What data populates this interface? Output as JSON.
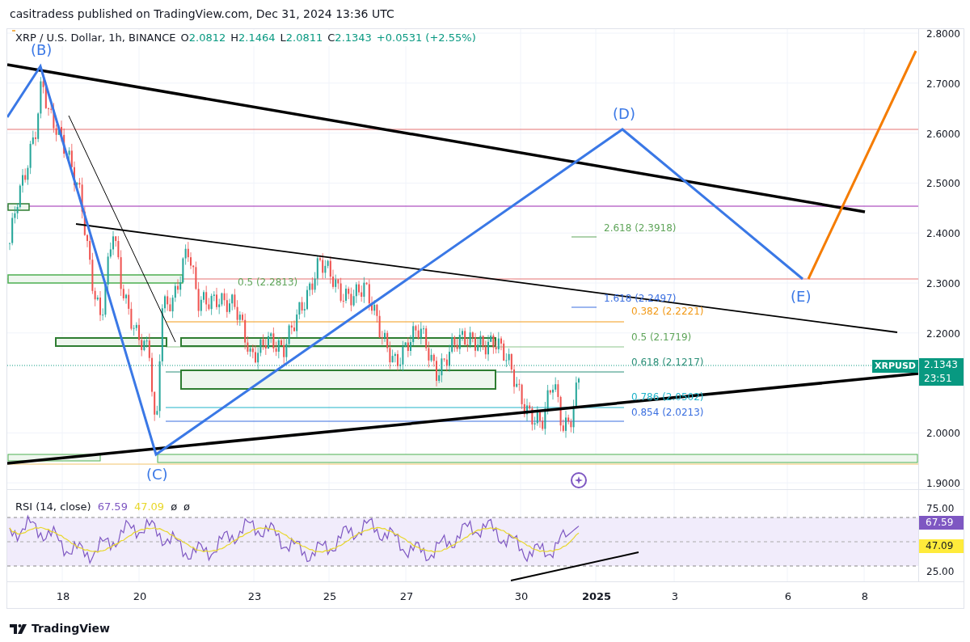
{
  "attribution": "casitradess published on TradingView.com, Dec 31, 2024 13:36 UTC",
  "legend": {
    "symbol": "XRP / U.S. Dollar, 1h, BINANCE",
    "ohlc": [
      {
        "key": "O",
        "value": "2.0812"
      },
      {
        "key": "H",
        "value": "2.1464"
      },
      {
        "key": "L",
        "value": "2.0811"
      },
      {
        "key": "C",
        "value": "2.1343"
      }
    ],
    "change": "+0.0531 (+2.55%)"
  },
  "wave_labels": [
    "(B)",
    "(C)",
    "(D)",
    "(E)"
  ],
  "fib_labels": [
    {
      "text": "2.618 (2.3918)",
      "color": "#5fa55a"
    },
    {
      "text": "0.5 (2.2813)",
      "color": "#5fa55a"
    },
    {
      "text": "1.618 (2.2497)",
      "color": "#3a6fe0"
    },
    {
      "text": "0.382 (2.2221)",
      "color": "#f29a18"
    },
    {
      "text": "0.5 (2.1719)",
      "color": "#5fa55a"
    },
    {
      "text": "0.618 (2.1217)",
      "color": "#2b8f78"
    },
    {
      "text": "0.786 (2.0502)",
      "color": "#1fb3c9"
    },
    {
      "text": "0.854 (2.0213)",
      "color": "#3a6fe0"
    }
  ],
  "price_axis": [
    "2.8000",
    "2.7000",
    "2.6000",
    "2.5000",
    "2.4000",
    "2.3000",
    "2.2000",
    "2.0000",
    "1.9000"
  ],
  "price_tag": {
    "symbol": "XRPUSD",
    "price": "2.1343",
    "countdown": "23:51"
  },
  "rsi": {
    "title": "RSI (14, close)",
    "legend": [
      {
        "text": "67.59",
        "color": "#7e57c2"
      },
      {
        "text": "47.09",
        "color": "#e8d72a"
      },
      {
        "text": "ø",
        "color": "#131722"
      },
      {
        "text": "ø",
        "color": "#131722"
      }
    ],
    "axis": [
      "75.00",
      "25.00"
    ],
    "tags": [
      {
        "text": "67.59",
        "color": "#7e57c2"
      },
      {
        "text": "47.09",
        "color": "#ffeb3b"
      }
    ]
  },
  "time_axis": [
    {
      "label": "18",
      "kind": "day"
    },
    {
      "label": "20",
      "kind": "day"
    },
    {
      "label": "23",
      "kind": "day"
    },
    {
      "label": "25",
      "kind": "day"
    },
    {
      "label": "27",
      "kind": "day"
    },
    {
      "label": "30",
      "kind": "day"
    },
    {
      "label": "2025",
      "kind": "year"
    },
    {
      "label": "3",
      "kind": "day"
    },
    {
      "label": "6",
      "kind": "day"
    },
    {
      "label": "8",
      "kind": "day"
    }
  ],
  "footer": {
    "brand": "TradingView"
  }
}
